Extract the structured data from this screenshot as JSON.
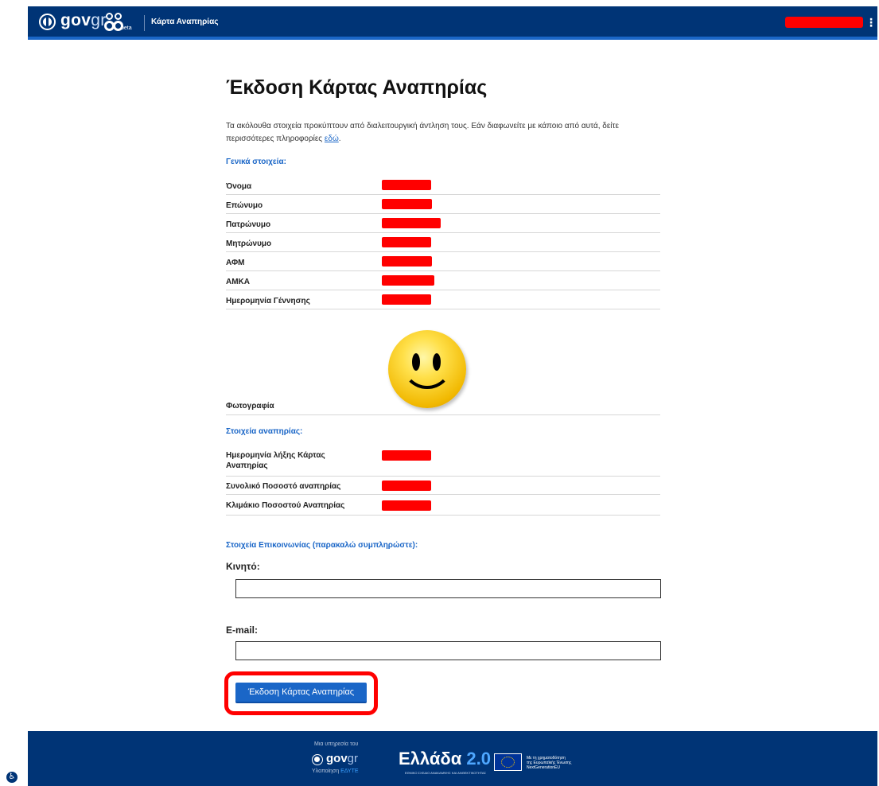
{
  "header": {
    "logo_text": "gov",
    "logo_suffix": "gr",
    "beta": "beta",
    "app_title": "Κάρτα Αναπηρίας",
    "menu_glyph": "⋮",
    "icons": [
      "emblem-icon",
      "apps-icon",
      "kebab-menu-icon"
    ],
    "colors": {
      "bar": "#003476",
      "accent": "#1a66c7"
    }
  },
  "main": {
    "title": "Έκδοση Κάρτας Αναπηρίας",
    "intro": "Τα ακόλουθα στοιχεία προκύπτουν από διαλειτουργική άντληση τους. Εάν διαφωνείτε με κάποιο από αυτά, δείτε περισσότερες πληροφορίες",
    "intro_link": "εδώ",
    "intro_end": ".",
    "general_section": "Γενικά στοιχεία:",
    "general_rows": [
      {
        "label": "Όνομα"
      },
      {
        "label": "Επώνυμο"
      },
      {
        "label": "Πατρώνυμο"
      },
      {
        "label": "Μητρώνυμο"
      },
      {
        "label": "ΑΦΜ"
      },
      {
        "label": "ΑΜΚΑ"
      },
      {
        "label": "Ημερομηνία Γέννησης"
      }
    ],
    "photo_label": "Φωτογραφία",
    "disability_section": "Στοιχεία αναπηρίας:",
    "disability_rows": [
      {
        "label": "Ημερομηνία λήξης Κάρτας Αναπηρίας"
      },
      {
        "label": "Συνολικό Ποσοστό αναπηρίας"
      },
      {
        "label": "Κλιμάκιο Ποσοστού Αναπηρίας"
      }
    ],
    "contact_section": "Στοιχεία Επικοινωνίας (παρακαλώ συμπληρώστε):",
    "mobile_label": "Κινητό:",
    "mobile_value": "",
    "email_label": "E-mail:",
    "email_value": "",
    "submit_label": "Έκδοση Κάρτας Αναπηρίας",
    "redaction_color": "#ff0000"
  },
  "footer": {
    "service_of": "Μια υπηρεσία του",
    "logo_text": "gov",
    "logo_suffix": "gr",
    "implementation": "Υλοποίηση",
    "implementer": "ΕΔΥΤΕ",
    "greece": "Ελλάδα",
    "greece_version": "2.0",
    "greece_sub": "ΕΘΝΙΚΟ ΣΧΕΔΙΟ ΑΝΑΚΑΜΨΗΣ ΚΑΙ ΑΝΘΕΚΤΙΚΟΤΗΤΑΣ",
    "eu_line1": "Με τη χρηματοδότηση",
    "eu_line2": "της Ευρωπαϊκής Ένωσης",
    "eu_line3": "NextGenerationEU",
    "accessibility_glyph": "♿"
  }
}
